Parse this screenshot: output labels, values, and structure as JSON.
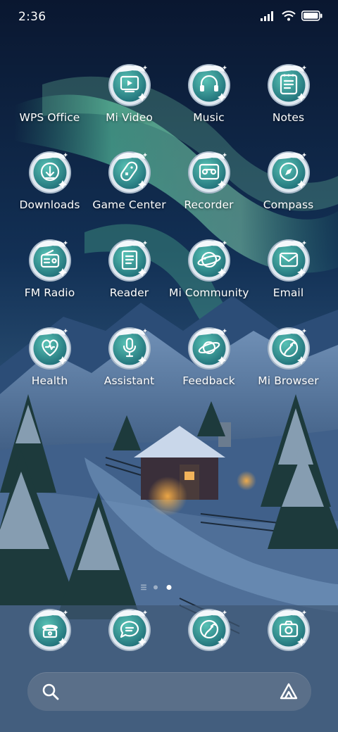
{
  "status_bar": {
    "time": "2:36"
  },
  "home": {
    "apps": [
      {
        "label": "WPS Office",
        "icon": "wps-office-icon",
        "has_icon": false
      },
      {
        "label": "Mi Video",
        "icon": "video-icon",
        "has_icon": true
      },
      {
        "label": "Music",
        "icon": "headphones-icon",
        "has_icon": true
      },
      {
        "label": "Notes",
        "icon": "notes-icon",
        "has_icon": true
      },
      {
        "label": "Downloads",
        "icon": "download-icon",
        "has_icon": true
      },
      {
        "label": "Game Center",
        "icon": "game-controller-icon",
        "has_icon": true
      },
      {
        "label": "Recorder",
        "icon": "cassette-icon",
        "has_icon": true
      },
      {
        "label": "Compass",
        "icon": "compass-icon",
        "has_icon": true
      },
      {
        "label": "FM Radio",
        "icon": "radio-icon",
        "has_icon": true
      },
      {
        "label": "Reader",
        "icon": "book-icon",
        "has_icon": true
      },
      {
        "label": "Mi Community",
        "icon": "planet-icon",
        "has_icon": true
      },
      {
        "label": "Email",
        "icon": "envelope-icon",
        "has_icon": true
      },
      {
        "label": "Health",
        "icon": "heart-icon",
        "has_icon": true
      },
      {
        "label": "Assistant",
        "icon": "microphone-icon",
        "has_icon": true
      },
      {
        "label": "Feedback",
        "icon": "saturn-icon",
        "has_icon": true
      },
      {
        "label": "Mi Browser",
        "icon": "browser-icon",
        "has_icon": true
      }
    ],
    "page_indicator": {
      "pages": 3,
      "current": 3
    }
  },
  "dock": [
    {
      "icon": "phone-icon"
    },
    {
      "icon": "message-icon"
    },
    {
      "icon": "browser-icon"
    },
    {
      "icon": "camera-icon"
    }
  ],
  "search": {
    "left_icon": "search-icon",
    "right_icon": "assistant-a-icon"
  },
  "colors": {
    "icon_teal": "#2f9c93",
    "icon_ring": "#c9d6e2",
    "sky_top": "#0b1a33",
    "aurora": "#58c9a4"
  }
}
